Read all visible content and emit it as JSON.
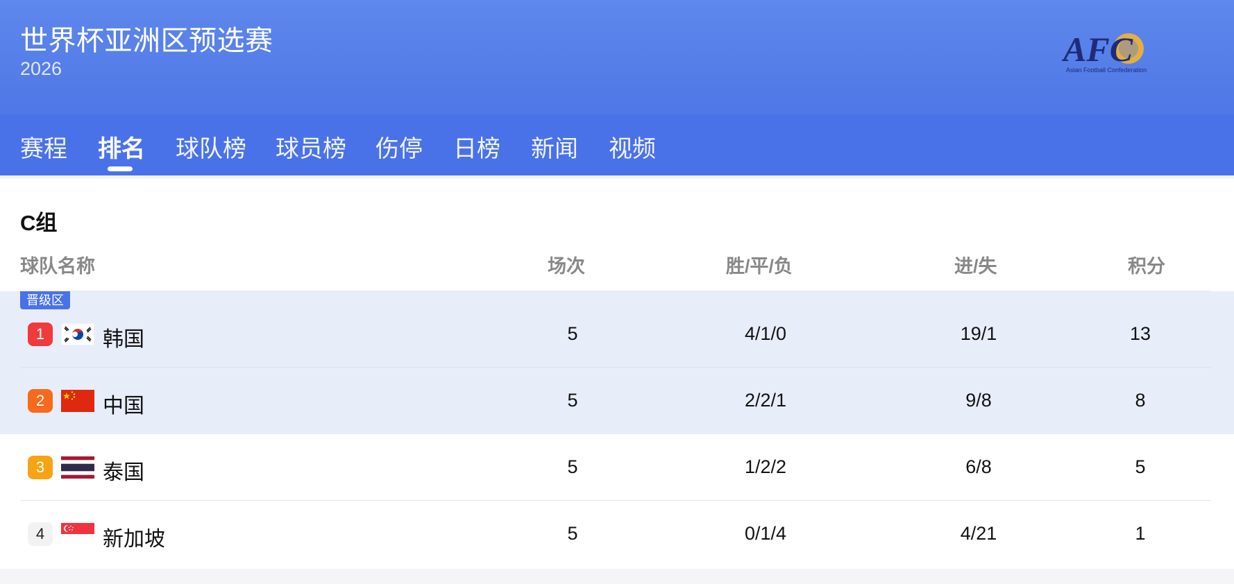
{
  "header": {
    "title": "世界杯亚洲区预选赛",
    "year": "2026",
    "logo_text": "AFC",
    "logo_subtext": "Asian Football Confederation"
  },
  "nav": {
    "tabs": [
      {
        "label": "赛程",
        "active": false
      },
      {
        "label": "排名",
        "active": true
      },
      {
        "label": "球队榜",
        "active": false
      },
      {
        "label": "球员榜",
        "active": false
      },
      {
        "label": "伤停",
        "active": false
      },
      {
        "label": "日榜",
        "active": false
      },
      {
        "label": "新闻",
        "active": false
      },
      {
        "label": "视频",
        "active": false
      }
    ]
  },
  "standings": {
    "group_title": "C组",
    "columns": [
      "球队名称",
      "场次",
      "胜/平/负",
      "进/失",
      "积分"
    ],
    "zone_label": "晋级区",
    "rows": [
      {
        "rank": "1",
        "team": "韩国",
        "played": "5",
        "wdl": "4/1/0",
        "goals": "19/1",
        "points": "13",
        "rank_color": "#ef3b3b",
        "flag": "korea-flag-icon"
      },
      {
        "rank": "2",
        "team": "中国",
        "played": "5",
        "wdl": "2/2/1",
        "goals": "9/8",
        "points": "8",
        "rank_color": "#f76a1b",
        "flag": "china-flag-icon"
      },
      {
        "rank": "3",
        "team": "泰国",
        "played": "5",
        "wdl": "1/2/2",
        "goals": "6/8",
        "points": "5",
        "rank_color": "#f7a414",
        "flag": "thailand-flag-icon"
      },
      {
        "rank": "4",
        "team": "新加坡",
        "played": "5",
        "wdl": "0/1/4",
        "goals": "4/21",
        "points": "1",
        "rank_color": "#f2f2f2",
        "flag": "singapore-flag-icon"
      }
    ]
  },
  "colors": {
    "header_bg": "#5e88ec",
    "nav_bg": "#4a72e8",
    "zone_bg": "#e8edfa"
  }
}
